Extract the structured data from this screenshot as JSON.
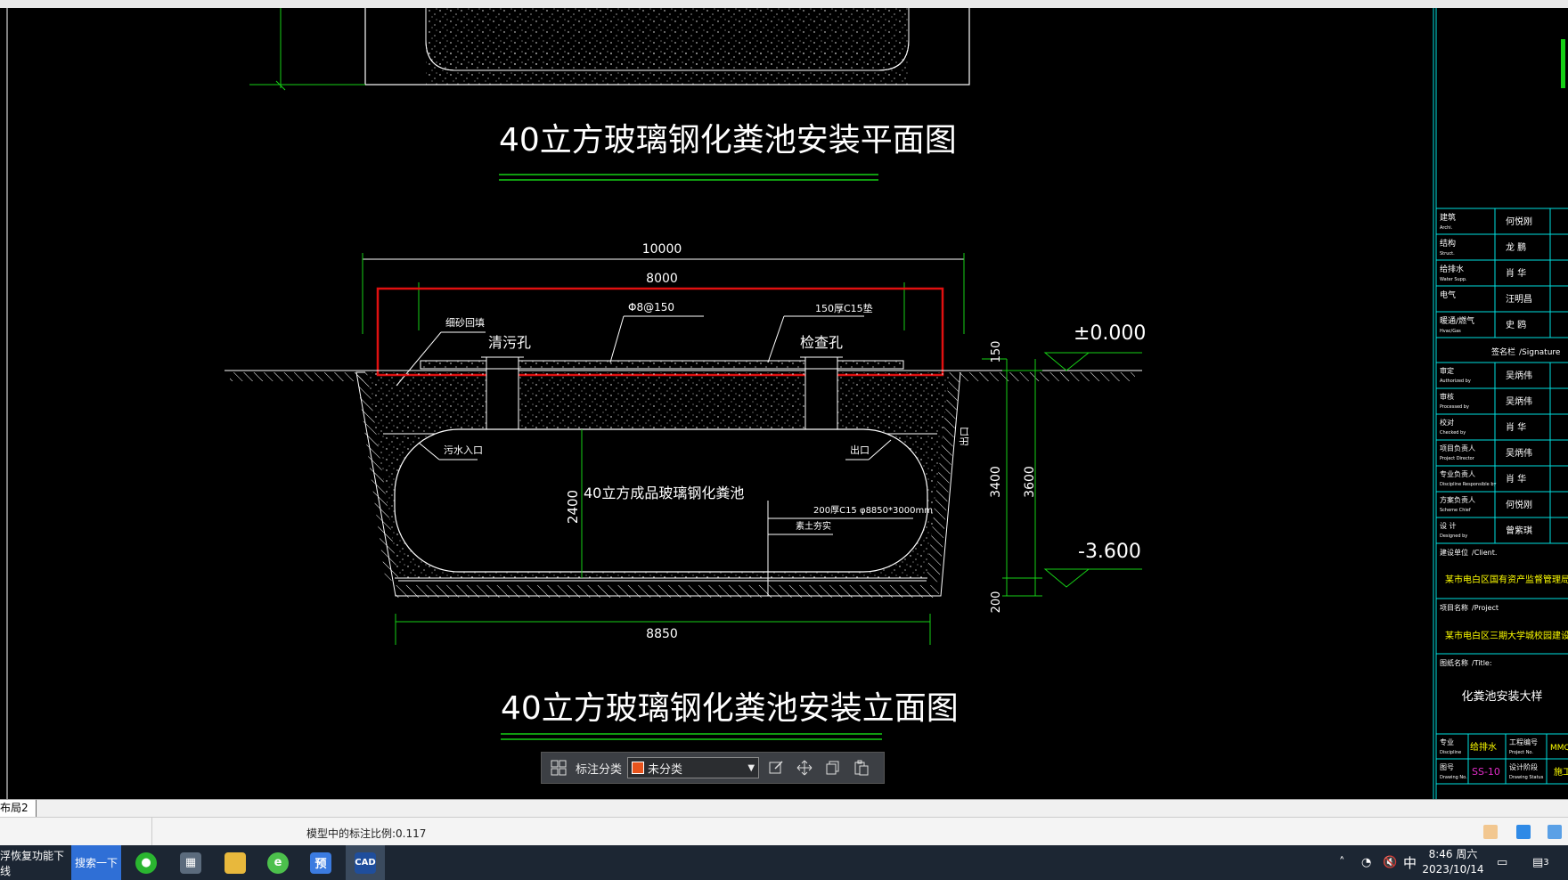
{
  "drawing": {
    "plan_title": "40立方玻璃钢化粪池安装平面图",
    "elevation_title": "40立方玻璃钢化粪池安装立面图",
    "dim_total_width": "10000",
    "dim_slab_width": "8000",
    "rebar_label": "Φ8@150",
    "slab_label": "150厚C15垫",
    "fill_label": "细砂回填",
    "cleanout_label": "清污孔",
    "inspection_label": "检查孔",
    "level_top": "±0.000",
    "level_bottom": "-3.600",
    "dim_150": "150",
    "dim_3400": "3400",
    "dim_3600": "3600",
    "dim_200": "200",
    "dim_2400": "2400",
    "inlet_label": "污水入口",
    "outlet_label": "出口",
    "outlet_side": "出口",
    "tank_label": "40立方成品玻璃钢化粪池",
    "base_label": "200厚C15 φ8850*3000mm",
    "soil_label": "素土夯实",
    "dim_bottom_width": "8850"
  },
  "titleblock": {
    "rows": [
      {
        "zh": "建筑",
        "en": "Archi.",
        "name": "何悦刚"
      },
      {
        "zh": "结构",
        "en": "Struct.",
        "name": "龙 鹏"
      },
      {
        "zh": "给排水",
        "en": "Water Supp.",
        "name": "肖 华"
      },
      {
        "zh": "电气",
        "en": "",
        "name": "汪明昌"
      },
      {
        "zh": "暖通/燃气",
        "en": "Hvac/Gas",
        "name": "史 鸥"
      }
    ],
    "sign_header_zh": "签名栏",
    "sign_header_en": "/Signature",
    "roles": [
      {
        "zh": "审定",
        "en": "Authorized by",
        "name": "吴炳伟"
      },
      {
        "zh": "审核",
        "en": "Processed by",
        "name": "吴炳伟"
      },
      {
        "zh": "校对",
        "en": "Checked by",
        "name": "肖 华"
      },
      {
        "zh": "项目负责人",
        "en": "Project Director",
        "name": "吴炳伟"
      },
      {
        "zh": "专业负责人",
        "en": "Discipline Responsible by",
        "name": "肖 华"
      },
      {
        "zh": "方案负责人",
        "en": "Scheme Chief",
        "name": "何悦刚"
      },
      {
        "zh": "设 计",
        "en": "Designed by",
        "name": "曾紫琪"
      }
    ],
    "client_label": "建设单位",
    "client_en": "/Client.",
    "client_value": "某市电白区国有资产监督管理局",
    "project_label": "项目名称",
    "project_en": "/Project",
    "project_value": "某市电白区三期大学城校园建设工程",
    "title_label": "图纸名称",
    "title_en": "/Title:",
    "title_value": "化粪池安装大样",
    "specialty_label": "专业",
    "specialty_en": "Discipline",
    "specialty_value": "给排水",
    "projno_label": "工程编号",
    "projno_en": "Project No.",
    "projno_value": "MMQ",
    "drawno_label": "图号",
    "drawno_en": "Drawing No.",
    "drawno_value": "SS-10",
    "status_label": "设计阶段",
    "status_en": "Drawing Status",
    "status_value": "施工"
  },
  "toolbar": {
    "label": "标注分类",
    "selected": "未分类"
  },
  "tabbar": {
    "tab": "布局2"
  },
  "statusbar": {
    "scale_text": "模型中的标注比例:0.117"
  },
  "taskbar": {
    "text1": "浮恢复功能下线",
    "search": "搜索一下",
    "preview_app": "预",
    "cad_app": "CAD",
    "ime": "中",
    "time": "8:46 周六",
    "date": "2023/10/14",
    "notif_count": "3"
  },
  "colors": {
    "line_white": "#ffffff",
    "line_green": "#16d016",
    "line_cyan": "#00e0e0",
    "line_red": "#e01010",
    "label_yellow": "#ffff00"
  }
}
